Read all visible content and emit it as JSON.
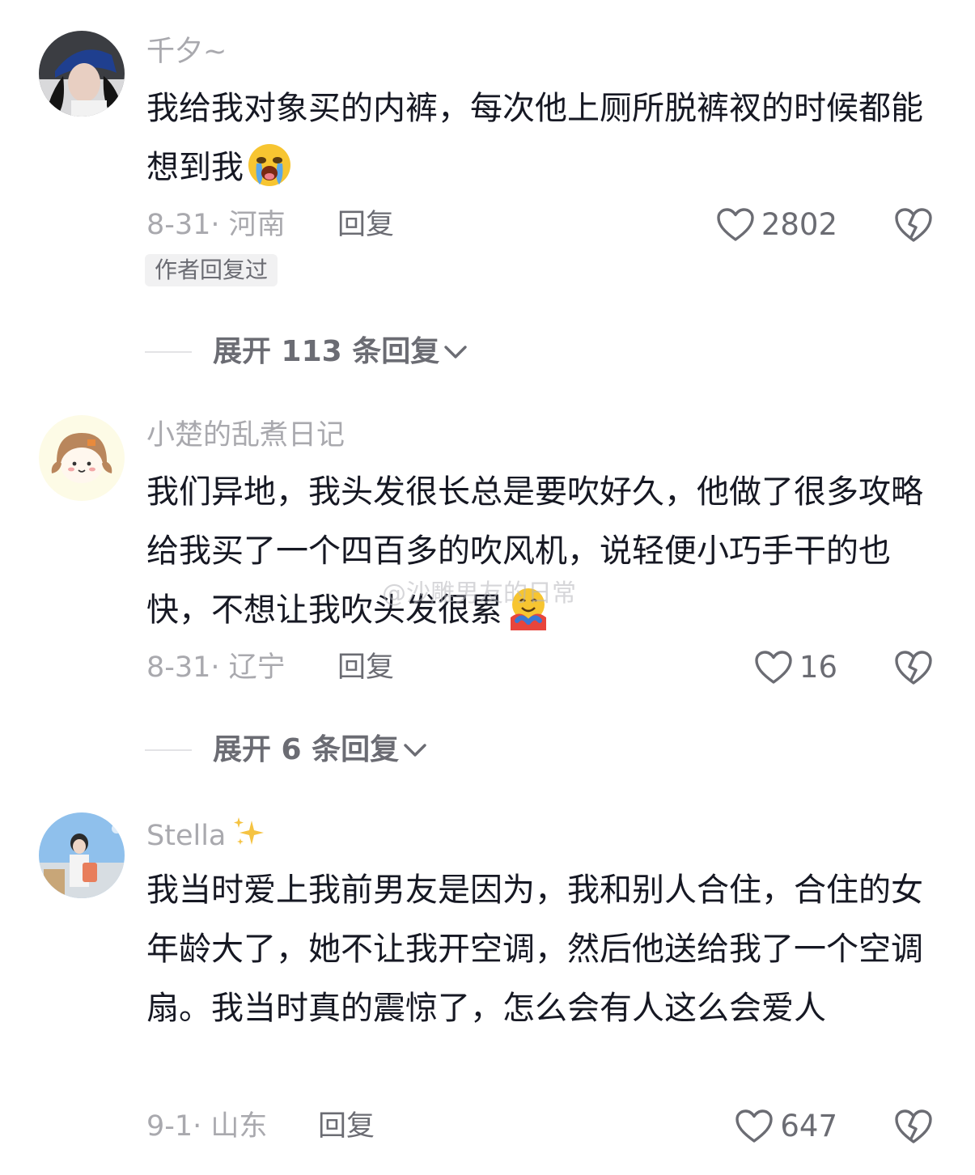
{
  "comments": [
    {
      "username": "千夕~",
      "text": "我给我对象买的内裤，每次他上厕所脱裤衩的时候都能想到我",
      "emoji": "loudly-crying-face",
      "date": "8-31",
      "location": "河南",
      "date_location": "8-31· 河南",
      "reply_label": "回复",
      "likes": "2802",
      "badge": "作者回复过",
      "expand_label": "展开 113 条回复"
    },
    {
      "username": "小楚的乱煮日记",
      "text": "我们异地，我头发很长总是要吹好久，他做了很多攻略给我买了一个四百多的吹风机，说轻便小巧手干的也快，不想让我吹头发很累",
      "emoji": "hugging-face",
      "date_location": "8-31· 辽宁",
      "reply_label": "回复",
      "likes": "16",
      "expand_label": "展开 6 条回复"
    },
    {
      "username": "Stella",
      "username_emoji": "sparkles",
      "text": "我当时爱上我前男友是因为，我和别人合住，合住的女年龄大了，她不让我开空调，然后他送给我了一个空调扇。我当时真的震惊了，怎么会有人这么会爱人",
      "date_location": "9-1· 山东",
      "reply_label": "回复",
      "likes": "647"
    }
  ],
  "watermark": "@沙雕男友的日常",
  "icons": {
    "like": "heart-outline-icon",
    "dislike": "broken-heart-icon",
    "expand": "chevron-down-icon"
  },
  "colors": {
    "text_primary": "#161823",
    "text_secondary": "#a9a9ae",
    "text_action": "#6b6c73"
  }
}
